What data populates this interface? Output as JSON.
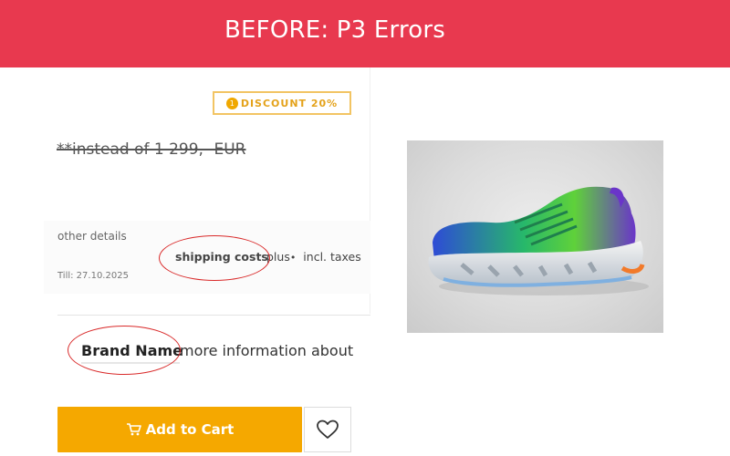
{
  "banner": {
    "title": "BEFORE: P3 Errors",
    "color": "#e8394f"
  },
  "discount": {
    "icon_text": "1",
    "label": "DISCOUNT 20%"
  },
  "price": {
    "old_price": "**instead of 1 299,- EUR"
  },
  "details": {
    "other_details": "other details",
    "till": "Till: 27.10.2025",
    "shipping_link": "shipping costs",
    "plus": "plus",
    "taxes": "incl. taxes"
  },
  "brand": {
    "name": "Brand Name",
    "more_info": "more information about"
  },
  "actions": {
    "add_to_cart": "Add to Cart",
    "cart_icon": "cart-icon",
    "wishlist_icon": "heart-icon",
    "accent": "#f5a800"
  },
  "annotation": {
    "circle_color": "#d92a2a"
  },
  "product_image": {
    "subject": "sneaker-image"
  }
}
